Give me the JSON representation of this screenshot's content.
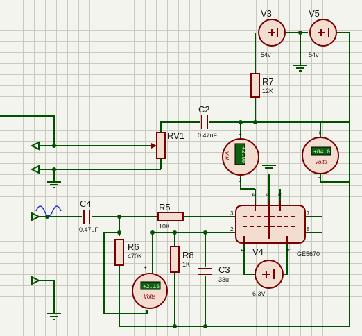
{
  "components": {
    "v3": {
      "ref": "V3",
      "value": "54v"
    },
    "v5": {
      "ref": "V5",
      "value": "54v"
    },
    "r7": {
      "ref": "R7",
      "value": "12K"
    },
    "c2": {
      "ref": "C2",
      "value": "0.47uF"
    },
    "rv1": {
      "ref": "RV1"
    },
    "c4": {
      "ref": "C4",
      "value": "0.47uF"
    },
    "r5": {
      "ref": "R5",
      "value": "10K"
    },
    "r6": {
      "ref": "R6",
      "value": "470K"
    },
    "r8": {
      "ref": "R8",
      "value": "1K"
    },
    "c3": {
      "ref": "C3",
      "value": "33u"
    },
    "v4": {
      "ref": "V4",
      "value": "6.3V"
    },
    "tube": {
      "ref": "GE5670",
      "pins": {
        "p3": "3",
        "p7": "7",
        "p2": "2",
        "p8": "8",
        "p4": "4",
        "p5": "5",
        "p6": "6",
        "p1": "1",
        "p9": "9"
      }
    }
  },
  "meters": {
    "ammeter": {
      "reading": "+2.00",
      "unit": "mA"
    },
    "voltmeter_plate": {
      "reading": "+84.0",
      "unit": "Volts"
    },
    "voltmeter_cathode": {
      "reading": "+2.16",
      "unit": "Volts"
    }
  },
  "symbols": {
    "plus": "+",
    "minus": "−",
    "one": "1",
    "source_pos": "+",
    "source_neg": "|"
  }
}
